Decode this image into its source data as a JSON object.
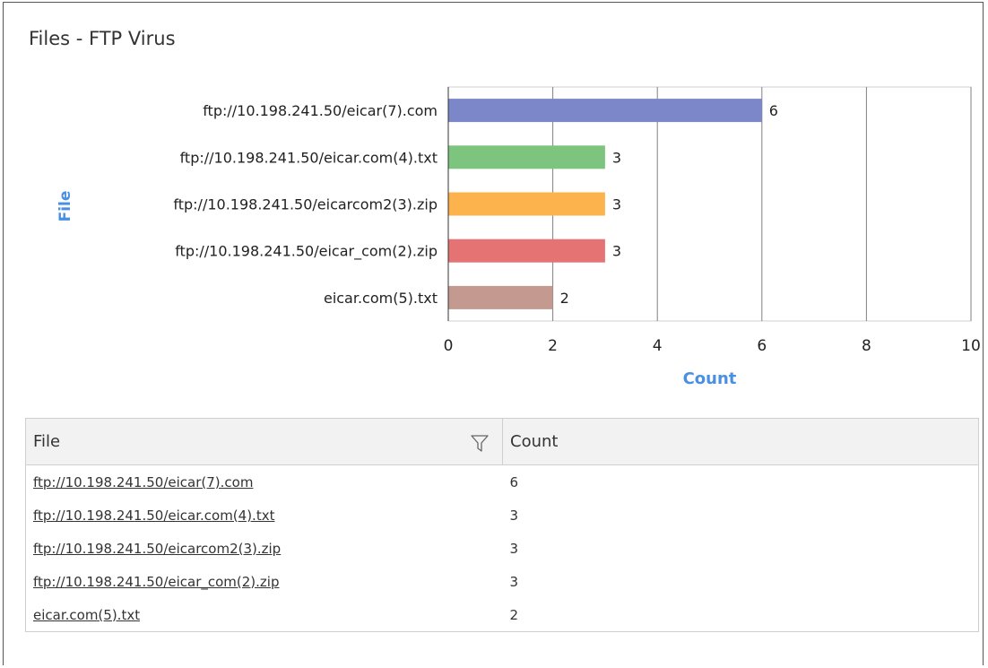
{
  "panel": {
    "title": "Files - FTP Virus"
  },
  "chart_data": {
    "type": "bar",
    "orientation": "horizontal",
    "categories": [
      "ftp://10.198.241.50/eicar(7).com",
      "ftp://10.198.241.50/eicar.com(4).txt",
      "ftp://10.198.241.50/eicarcom2(3).zip",
      "ftp://10.198.241.50/eicar_com(2).zip",
      "eicar.com(5).txt"
    ],
    "values": [
      6,
      3,
      3,
      3,
      2
    ],
    "colors": [
      "#7b87c9",
      "#7dc47f",
      "#fdb34d",
      "#e57373",
      "#c49a90"
    ],
    "data_labels": [
      "6",
      "3",
      "3",
      "3",
      "2"
    ],
    "xlabel": "Count",
    "ylabel": "File",
    "xlim": [
      0,
      10
    ],
    "xticks": [
      0,
      2,
      4,
      6,
      8,
      10
    ],
    "xtick_labels": [
      "0",
      "2",
      "4",
      "6",
      "8",
      "10"
    ],
    "grid": "vertical",
    "axis_title_color": "#4a90e2"
  },
  "table": {
    "headers": [
      "File",
      "Count"
    ],
    "filter_icon": "filter-icon",
    "rows": [
      {
        "file": "ftp://10.198.241.50/eicar(7).com",
        "count": "6"
      },
      {
        "file": "ftp://10.198.241.50/eicar.com(4).txt",
        "count": "3"
      },
      {
        "file": "ftp://10.198.241.50/eicarcom2(3).zip",
        "count": "3"
      },
      {
        "file": "ftp://10.198.241.50/eicar_com(2).zip",
        "count": "3"
      },
      {
        "file": "eicar.com(5).txt",
        "count": "2"
      }
    ]
  }
}
